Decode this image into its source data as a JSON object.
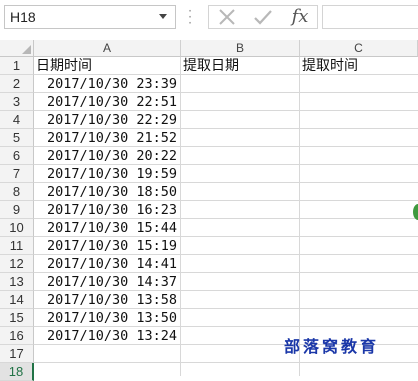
{
  "formula_bar": {
    "name_box": "H18",
    "fx_label": "fx",
    "formula_value": ""
  },
  "columns": [
    "A",
    "B",
    "C"
  ],
  "rows": [
    "1",
    "2",
    "3",
    "4",
    "5",
    "6",
    "7",
    "8",
    "9",
    "10",
    "11",
    "12",
    "13",
    "14",
    "15",
    "16",
    "17",
    "18"
  ],
  "headers": {
    "a": "日期时间",
    "b": "提取日期",
    "c": "提取时间"
  },
  "datetimes": [
    "2017/10/30 23:39",
    "2017/10/30 22:51",
    "2017/10/30 22:29",
    "2017/10/30 21:52",
    "2017/10/30 20:22",
    "2017/10/30 19:59",
    "2017/10/30 18:50",
    "2017/10/30 16:23",
    "2017/10/30 15:44",
    "2017/10/30 15:19",
    "2017/10/30 14:41",
    "2017/10/30 14:37",
    "2017/10/30 13:58",
    "2017/10/30 13:50",
    "2017/10/30 13:24"
  ],
  "watermark": "部落窝教育",
  "colors": {
    "accent": "#217346",
    "watermark": "#1a37a8",
    "gridline": "#d8d8d8"
  },
  "icons": [
    "cancel-x-icon",
    "enter-check-icon",
    "fx-icon",
    "dropdown-arrow-icon"
  ]
}
